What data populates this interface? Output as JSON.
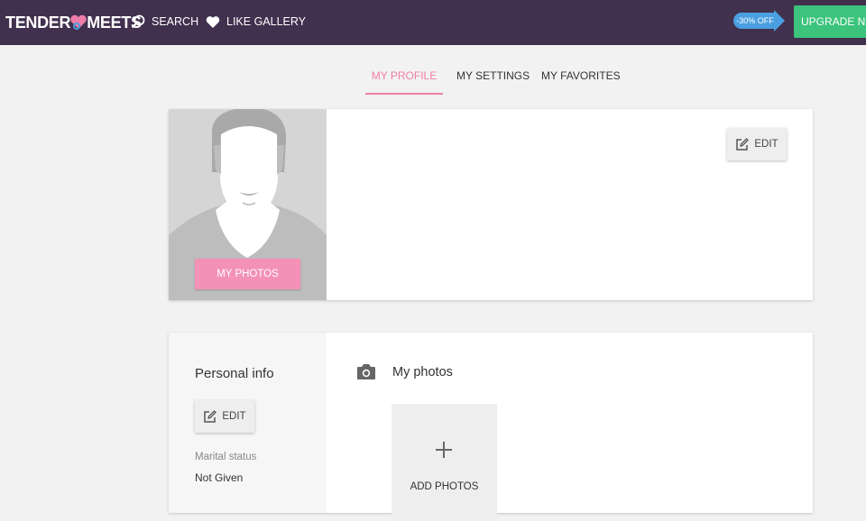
{
  "header": {
    "logo_left": "TENDER",
    "logo_right": "MEETS",
    "logo_icon": "heart-ring-icon",
    "nav": [
      {
        "label": "SEARCH",
        "icon": "search-icon"
      },
      {
        "label": "LIKE GALLERY",
        "icon": "heart-icon"
      }
    ],
    "discount_label": "-30% OFF",
    "upgrade_label": "UPGRADE NOW"
  },
  "tabs": [
    {
      "label": "MY PROFILE",
      "active": true
    },
    {
      "label": "MY SETTINGS",
      "active": false
    },
    {
      "label": "MY FAVORITES",
      "active": false
    }
  ],
  "profile": {
    "my_photos_label": "MY PHOTOS",
    "edit_label": "EDIT"
  },
  "personal_info": {
    "title": "Personal info",
    "edit_label": "EDIT",
    "marital_status_label": "Marital status",
    "marital_status_value": "Not Given"
  },
  "photos": {
    "title": "My photos",
    "icon": "camera-icon",
    "add_label": "ADD PHOTOS"
  },
  "colors": {
    "header_bg": "#41304e",
    "accent_pink": "#ee7ea7",
    "upgrade_green": "#3cc37c",
    "discount_blue": "#4a9fe0"
  }
}
